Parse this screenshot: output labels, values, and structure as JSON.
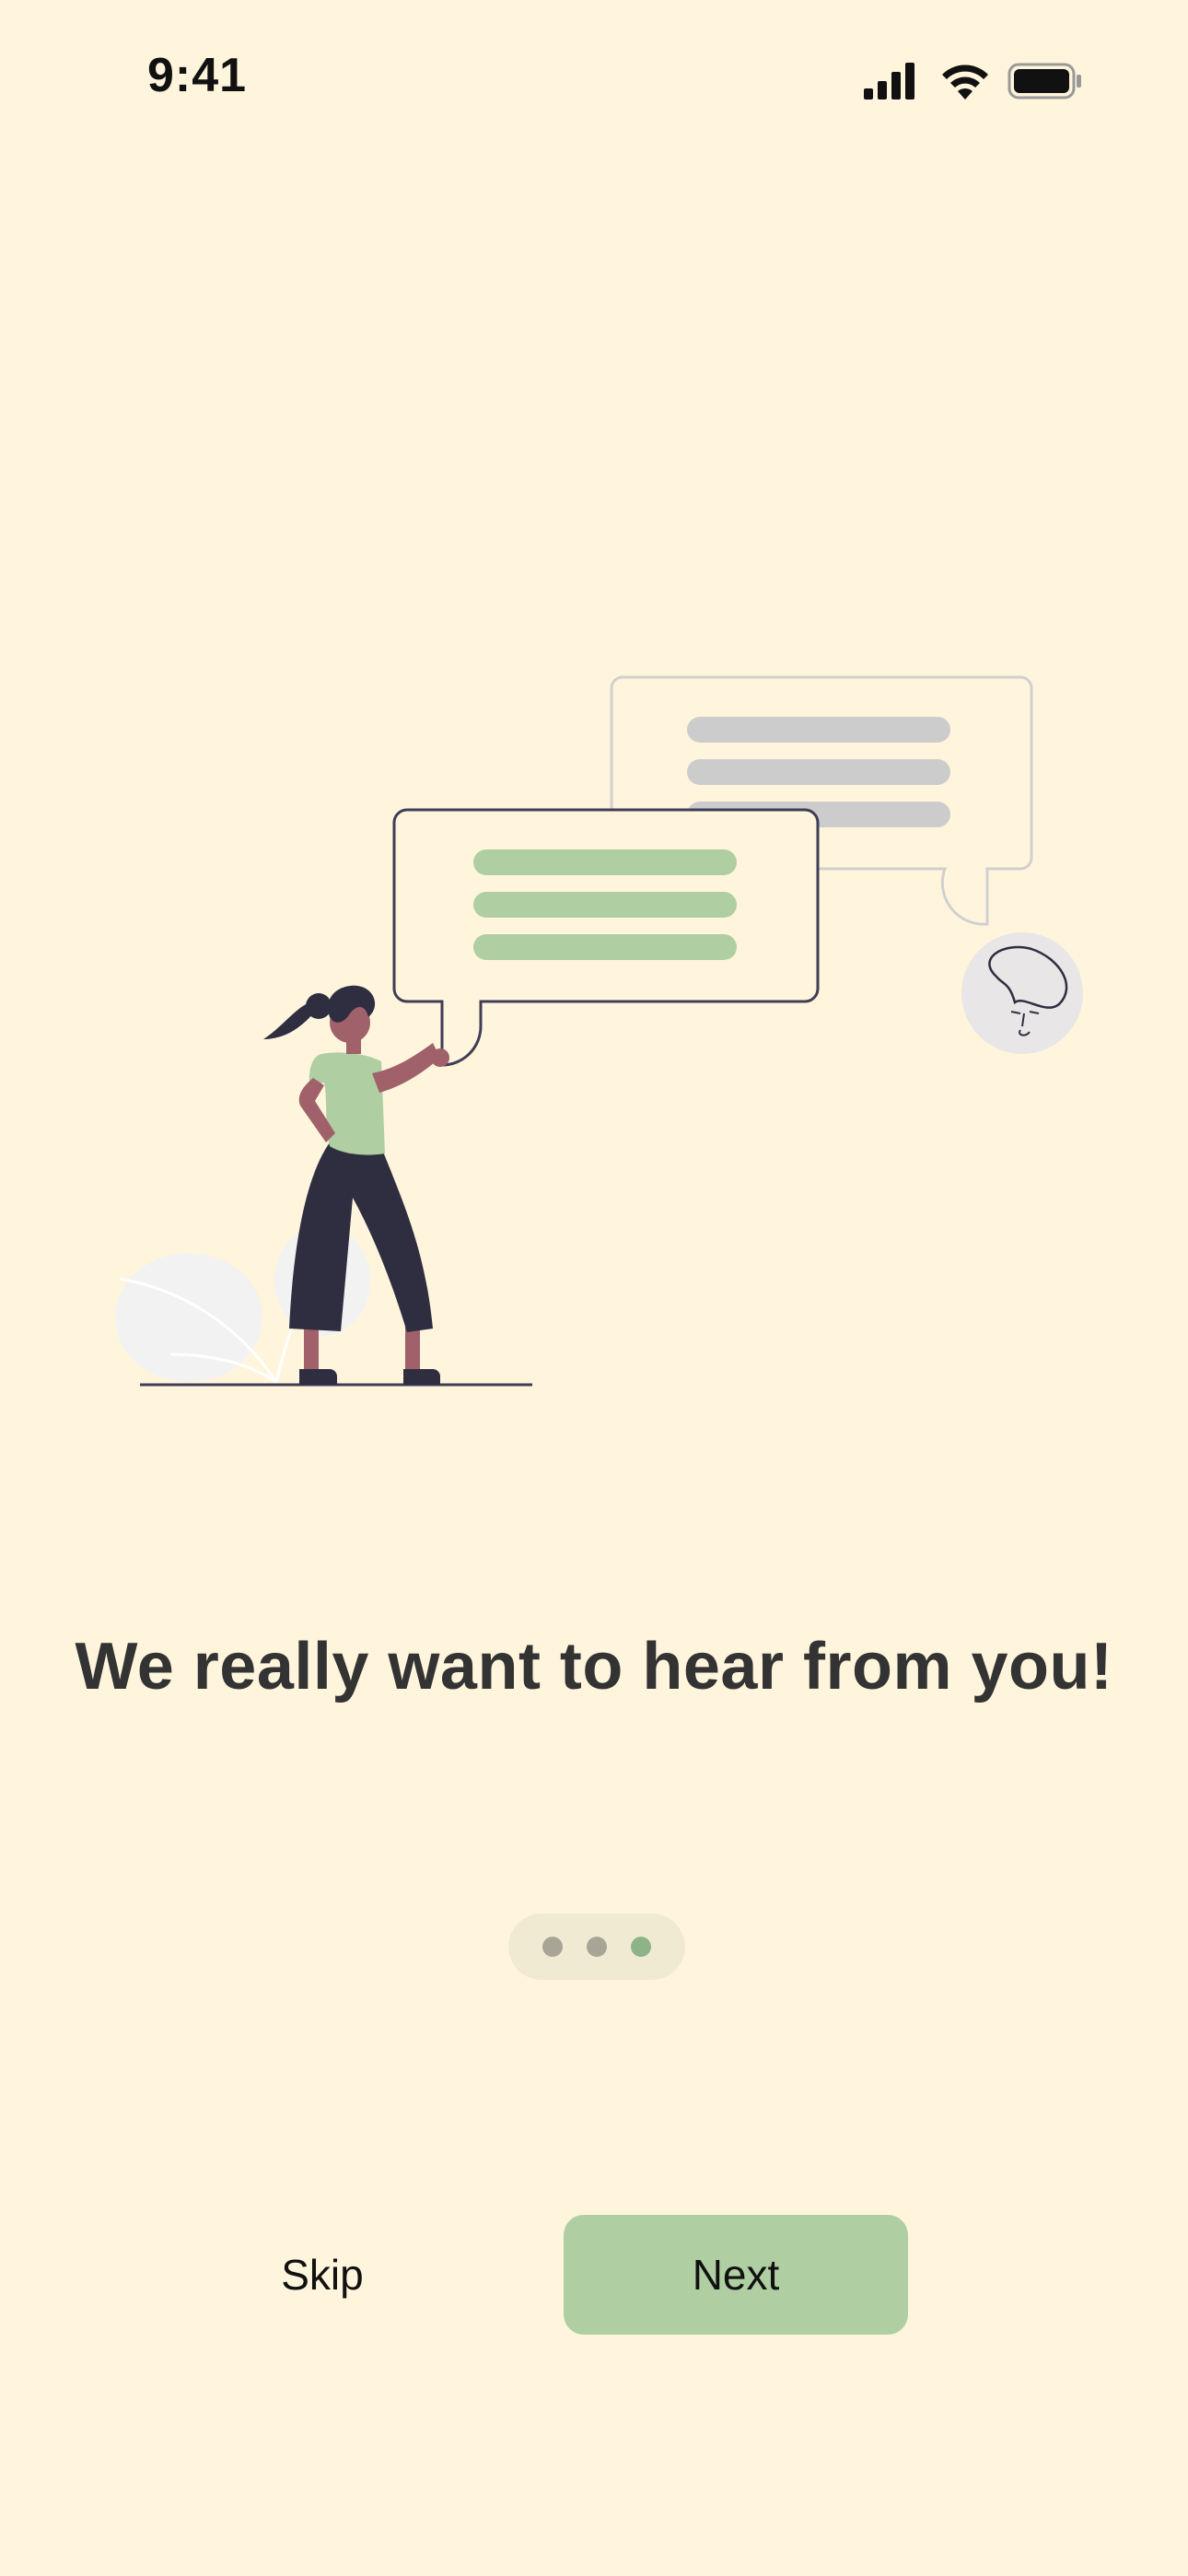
{
  "status_bar": {
    "time": "9:41",
    "icons": [
      "cellular-signal-icon",
      "wifi-icon",
      "battery-icon"
    ]
  },
  "illustration": {
    "name": "woman-holding-speech-bubble",
    "colors": {
      "bubble_lines_active": "#afcea2",
      "bubble_lines_faded": "#cccccc",
      "shirt": "#afcea2",
      "pants_hair": "#2f2e41",
      "skin": "#a0616a"
    }
  },
  "onboarding": {
    "headline": "We really want to hear from you!",
    "pager": {
      "total_pages": 3,
      "current_page": 3
    }
  },
  "actions": {
    "skip_label": "Skip",
    "next_label": "Next"
  },
  "theme": {
    "background": "#fff5dc",
    "accent": "#afcea2",
    "text": "#333333"
  }
}
